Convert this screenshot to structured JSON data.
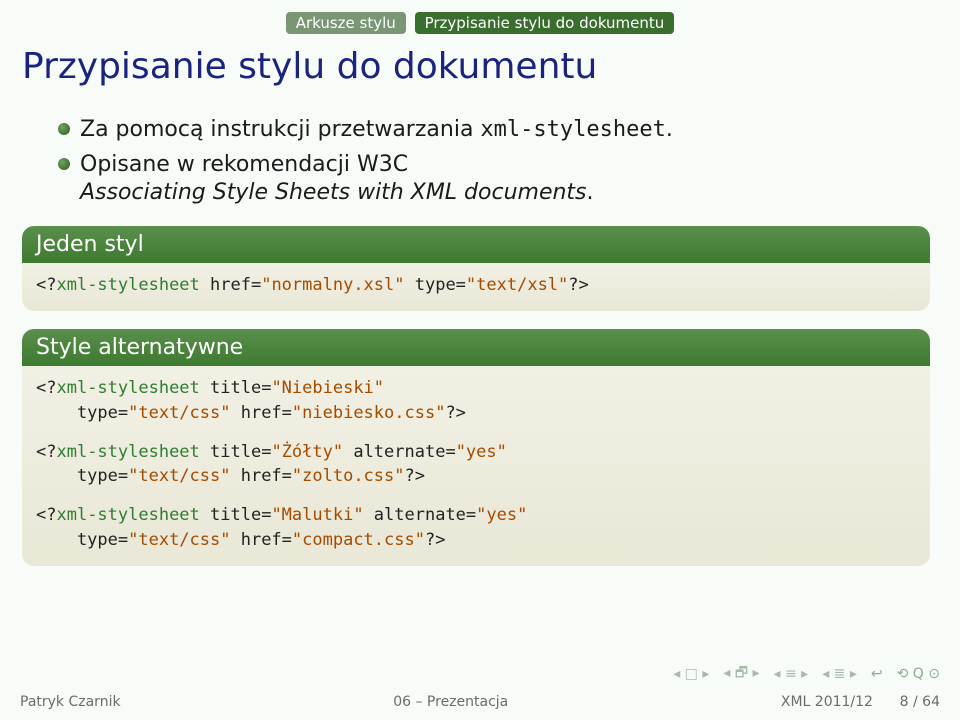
{
  "breadcrumb": {
    "a": "Arkusze stylu",
    "b": "Przypisanie stylu do dokumentu"
  },
  "title": "Przypisanie stylu do dokumentu",
  "bullets": {
    "b1_pre": "Za pomocą instrukcji przetwarzania ",
    "b1_code": "xml-stylesheet",
    "b1_post": ".",
    "b2_pre": "Opisane w rekomendacji W3C",
    "b2_em": "Associating Style Sheets with XML documents",
    "b2_post": "."
  },
  "box1": {
    "head": "Jeden styl",
    "l1a": "<?",
    "l1b": "xml-stylesheet",
    "l1c": " href=",
    "l1d": "\"normalny.xsl\"",
    "l1e": " type=",
    "l1f": "\"text/xsl\"",
    "l1g": "?>"
  },
  "box2": {
    "head": "Style alternatywne",
    "a1a": "<?",
    "a1b": "xml-stylesheet",
    "a1c": " title=",
    "a1d": "\"Niebieski\"",
    "a2a": "    type=",
    "a2b": "\"text/css\"",
    "a2c": " href=",
    "a2d": "\"niebiesko.css\"",
    "a2e": "?>",
    "b1a": "<?",
    "b1b": "xml-stylesheet ",
    "b1c": " title=",
    "b1d": "\"Żółty\"",
    "b1e": " alternate=",
    "b1f": "\"yes\"",
    "b2a": "    type=",
    "b2b": "\"text/css\"",
    "b2c": " href=",
    "b2d": "\"zolto.css\"",
    "b2e": "?>",
    "c1a": "<?",
    "c1b": "xml-stylesheet ",
    "c1c": " title=",
    "c1d": "\"Malutki\"",
    "c1e": " alternate=",
    "c1f": "\"yes\"",
    "c2a": "    type=",
    "c2b": "\"text/css\"",
    "c2c": " href=",
    "c2d": "\"compact.css\"",
    "c2e": "?>"
  },
  "footer": {
    "left": "Patryk Czarnik",
    "center": "06 – Prezentacja",
    "right": "XML 2011/12      8 / 64"
  }
}
